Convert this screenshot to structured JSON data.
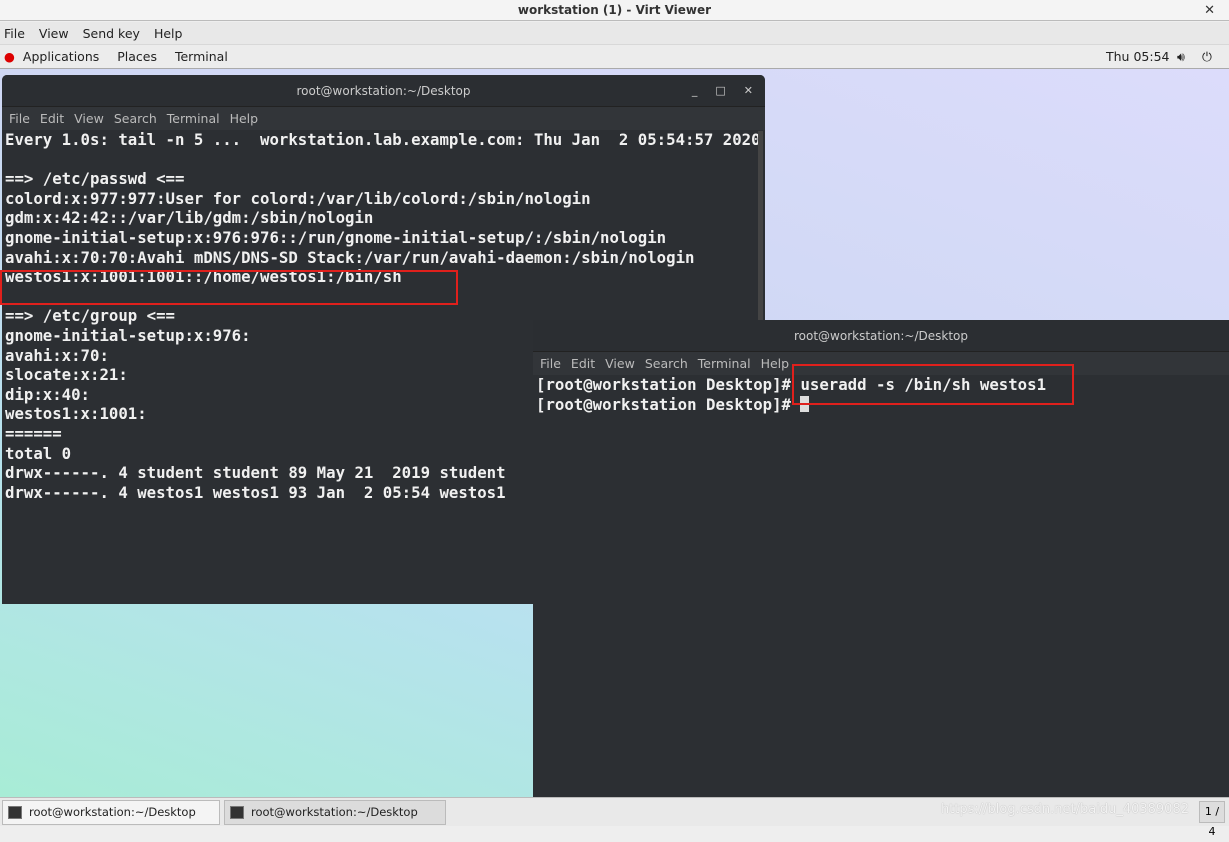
{
  "viewer": {
    "title": "workstation (1) - Virt Viewer",
    "menu": [
      "File",
      "View",
      "Send key",
      "Help"
    ]
  },
  "gnome": {
    "applications": "Applications",
    "places": "Places",
    "terminal": "Terminal",
    "clock": "Thu 05:54"
  },
  "term1": {
    "title": "root@workstation:~/Desktop",
    "menu": [
      "File",
      "Edit",
      "View",
      "Search",
      "Terminal",
      "Help"
    ],
    "lines": [
      "Every 1.0s: tail -n 5 ...  workstation.lab.example.com: Thu Jan  2 05:54:57 2020",
      "",
      "==> /etc/passwd <==",
      "colord:x:977:977:User for colord:/var/lib/colord:/sbin/nologin",
      "gdm:x:42:42::/var/lib/gdm:/sbin/nologin",
      "gnome-initial-setup:x:976:976::/run/gnome-initial-setup/:/sbin/nologin",
      "avahi:x:70:70:Avahi mDNS/DNS-SD Stack:/var/run/avahi-daemon:/sbin/nologin",
      "westos1:x:1001:1001::/home/westos1:/bin/sh",
      "",
      "==> /etc/group <==",
      "gnome-initial-setup:x:976:",
      "avahi:x:70:",
      "slocate:x:21:",
      "dip:x:40:",
      "westos1:x:1001:",
      "======",
      "total 0",
      "drwx------. 4 student student 89 May 21  2019 student",
      "drwx------. 4 westos1 westos1 93 Jan  2 05:54 westos1"
    ]
  },
  "term2": {
    "title": "root@workstation:~/Desktop",
    "menu": [
      "File",
      "Edit",
      "View",
      "Search",
      "Terminal",
      "Help"
    ],
    "prompt": "[root@workstation Desktop]# ",
    "command": "useradd -s /bin/sh westos1"
  },
  "taskbar": {
    "items": [
      "root@workstation:~/Desktop",
      "root@workstation:~/Desktop"
    ],
    "watermark": "https://blog.csdn.net/baidu_40389082",
    "pager": "1 / 4"
  },
  "colors": {
    "highlight": "#e0201c",
    "terminal_bg": "#2c2f33"
  }
}
